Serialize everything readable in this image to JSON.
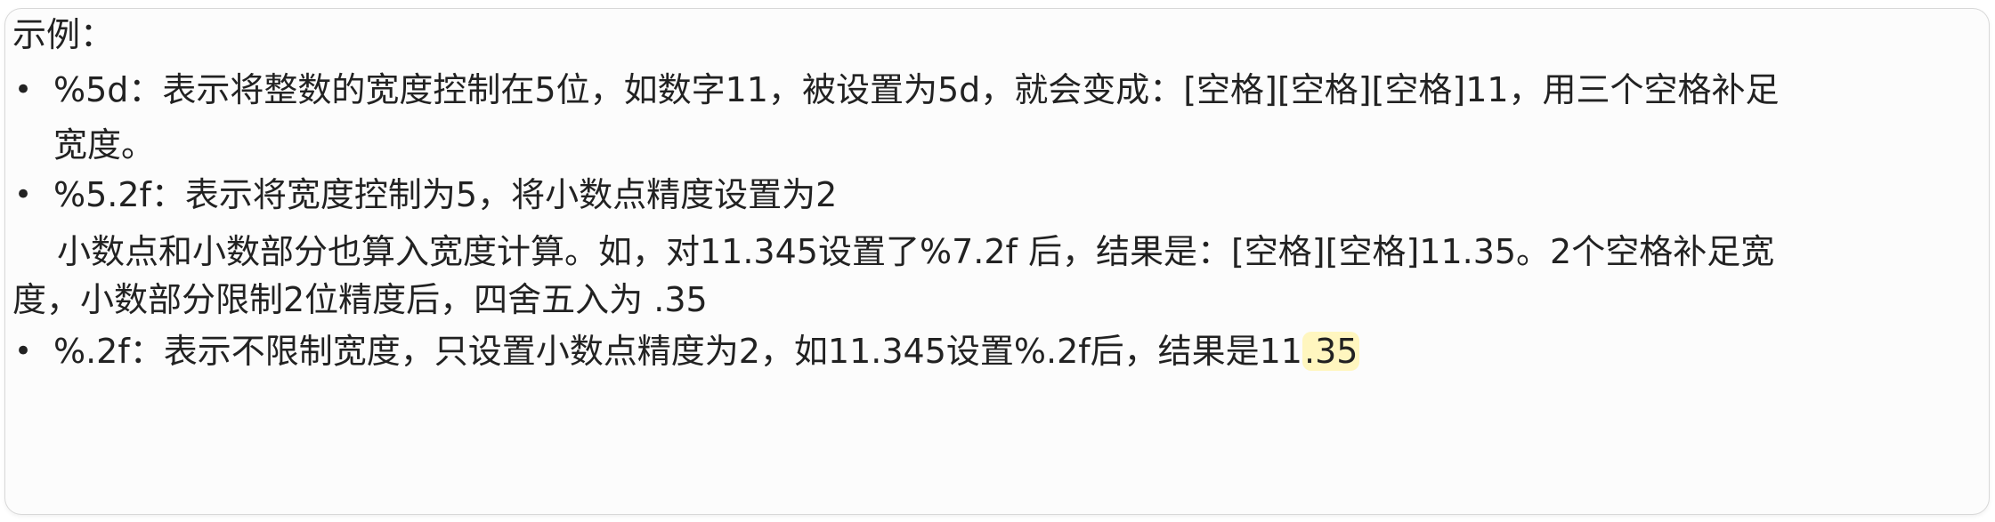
{
  "heading": "示例：",
  "bullets": [
    {
      "symbol": "•",
      "line1": "%5d：表示将整数的宽度控制在5位，如数字11，被设置为5d，就会变成：[空格][空格][空格]11，用三个空格补足",
      "line2": "宽度。"
    },
    {
      "symbol": "•",
      "line1": "%5.2f：表示将宽度控制为5，将小数点精度设置为2"
    }
  ],
  "paragraph": {
    "line1": "小数点和小数部分也算入宽度计算。如，对11.345设置了%7.2f 后，结果是：[空格][空格]11.35。2个空格补足宽",
    "line2": "度，小数部分限制2位精度后，四舍五入为 .35"
  },
  "last_bullet": {
    "symbol": "•",
    "text_before": "%.2f：表示不限制宽度，只设置小数点精度为2，如11.345设置%.2f后，结果是11",
    "text_highlight": ".35"
  },
  "colors": {
    "text": "#222222",
    "highlight": "#fff6bf"
  }
}
